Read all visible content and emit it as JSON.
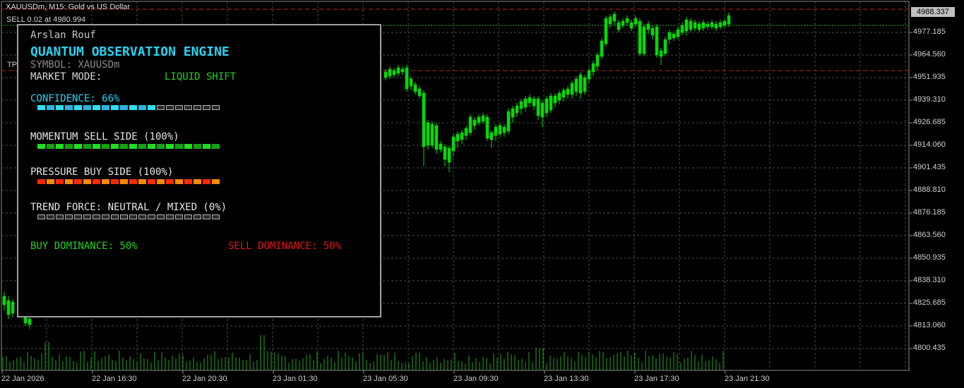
{
  "chart": {
    "header": "XAUUSDm, M15:  Gold vs US Dollar",
    "order_line": "SELL 0.02 at 4980.994",
    "tp_tag": "TP",
    "current_price": "4988.337",
    "price_labels": [
      "4977.185",
      "4964.560",
      "4951.935",
      "4939.310",
      "4926.685",
      "4914.060",
      "4901.435",
      "4888.810",
      "4876.185",
      "4863.560",
      "4850.935",
      "4838.310",
      "4825.685",
      "4813.060",
      "4800.435"
    ],
    "time_labels": [
      "22 Jan 2026",
      "22 Jan 16:30",
      "22 Jan 20:30",
      "23 Jan 01:30",
      "23 Jan 05:30",
      "23 Jan 09:30",
      "23 Jan 13:30",
      "23 Jan 17:30",
      "23 Jan 21:30"
    ],
    "colors": {
      "bull": "#ffffff",
      "bear": "#00dd00",
      "grid": "#4a4a4a",
      "volume": "#22aa22",
      "bid_line": "#22bb22",
      "sl_line": "#cc2222"
    }
  },
  "panel": {
    "author": "Arslan Rouf",
    "title": "QUANTUM OBSERVATION ENGINE",
    "symbol": "SYMBOL: XAUUSDm",
    "market_mode_label": "MARKET MODE:",
    "market_mode_value": "LIQUID SHIFT",
    "confidence": "CONFIDENCE: 66%",
    "confidence_level": 0.66,
    "momentum": "MOMENTUM SELL SIDE (100%)",
    "momentum_level": 1.0,
    "pressure": "PRESSURE BUY SIDE (100%)",
    "pressure_level": 1.0,
    "trend": "TREND FORCE: NEUTRAL / MIXED (0%)",
    "trend_level": 0.0,
    "buy_dominance": "BUY DOMINANCE: 50%",
    "sell_dominance": "SELL DOMINANCE: 50%"
  }
}
